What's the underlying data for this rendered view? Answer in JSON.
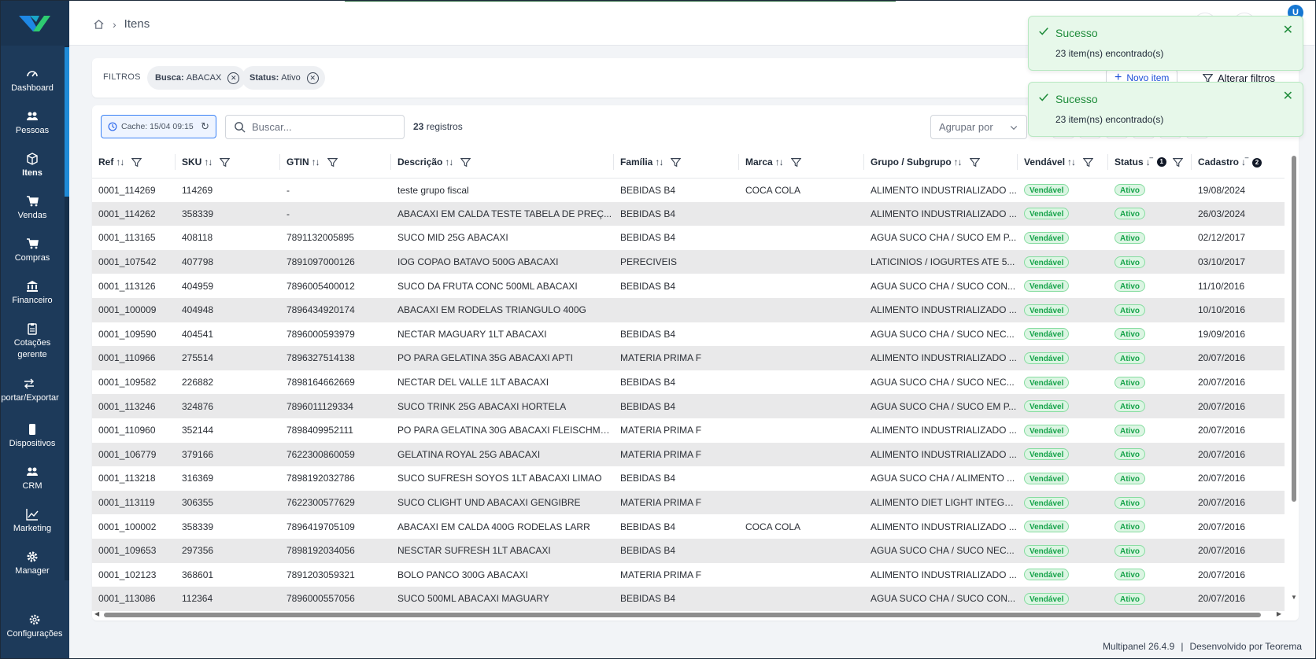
{
  "sidebar": {
    "items": [
      {
        "label": "Dashboard",
        "icon": "gauge-icon"
      },
      {
        "label": "Pessoas",
        "icon": "people-icon"
      },
      {
        "label": "Itens",
        "icon": "box-icon"
      },
      {
        "label": "Vendas",
        "icon": "cart-icon"
      },
      {
        "label": "Compras",
        "icon": "cart-icon"
      },
      {
        "label": "Financeiro",
        "icon": "bank-icon"
      },
      {
        "label": "Cotações",
        "label2": "gerente",
        "icon": "clipboard-icon"
      },
      {
        "label": "Importar/Exportar",
        "icon": "swap-icon"
      },
      {
        "label": "Dispositivos",
        "icon": "device-icon"
      },
      {
        "label": "CRM",
        "icon": "people-icon"
      },
      {
        "label": "Marketing",
        "icon": "chart-icon"
      },
      {
        "label": "Manager",
        "icon": "gear-icon"
      }
    ],
    "settings_label": "Configurações"
  },
  "header": {
    "breadcrumb_current": "Itens",
    "avatar_initial": "U"
  },
  "filters": {
    "title": "FILTROS",
    "chips": [
      {
        "key": "Busca:",
        "value": "ABACAX"
      },
      {
        "key": "Status:",
        "value": "Ativo"
      }
    ],
    "new_item_label": "Novo item",
    "alter_filters_label": "Alterar filtros"
  },
  "toolbar": {
    "cache_label": "Cache: 15/04 09:15",
    "search_placeholder": "Buscar...",
    "records_count": "23",
    "records_label": "registros",
    "group_by_placeholder": "Agrupar por"
  },
  "table": {
    "columns": [
      "Ref",
      "SKU",
      "GTIN",
      "Descrição",
      "Família",
      "Marca",
      "Grupo / Subgrupo",
      "Vendável",
      "Status",
      "Cadastro"
    ],
    "rows": [
      [
        "0001_114269",
        "114269",
        "-",
        "teste grupo fiscal",
        "BEBIDAS B4",
        "COCA COLA",
        "ALIMENTO INDUSTRIALIZADO ...",
        "Vendável",
        "Ativo",
        "19/08/2024"
      ],
      [
        "0001_114262",
        "358339",
        "-",
        "ABACAXI EM CALDA TESTE TABELA DE PREÇ...",
        "BEBIDAS B4",
        "",
        "ALIMENTO INDUSTRIALIZADO ...",
        "Vendável",
        "Ativo",
        "26/03/2024"
      ],
      [
        "0001_113165",
        "408118",
        "7891132005895",
        "SUCO MID 25G ABACAXI",
        "BEBIDAS B4",
        "",
        "AGUA SUCO CHA / SUCO EM P...",
        "Vendável",
        "Ativo",
        "02/12/2017"
      ],
      [
        "0001_107542",
        "407798",
        "7891097000126",
        "IOG COPAO BATAVO 500G ABACAXI",
        "PERECIVEIS",
        "",
        "LATICINIOS / IOGURTES ATE 5...",
        "Vendável",
        "Ativo",
        "03/10/2017"
      ],
      [
        "0001_113126",
        "404959",
        "7896005400012",
        "SUCO DA FRUTA CONC 500ML ABACAXI",
        "BEBIDAS B4",
        "",
        "AGUA SUCO CHA / SUCO CON...",
        "Vendável",
        "Ativo",
        "11/10/2016"
      ],
      [
        "0001_100009",
        "404948",
        "7896434920174",
        "ABACAXI EM RODELAS TRIANGULO 400G",
        "",
        "",
        "ALIMENTO INDUSTRIALIZADO ...",
        "Vendável",
        "Ativo",
        "10/10/2016"
      ],
      [
        "0001_109590",
        "404541",
        "7896000593979",
        "NECTAR MAGUARY 1LT ABACAXI",
        "BEBIDAS B4",
        "",
        "AGUA SUCO CHA / SUCO NEC...",
        "Vendável",
        "Ativo",
        "19/09/2016"
      ],
      [
        "0001_110966",
        "275514",
        "7896327514138",
        "PO PARA GELATINA 35G ABACAXI APTI",
        "MATERIA PRIMA F",
        "",
        "ALIMENTO INDUSTRIALIZADO ...",
        "Vendável",
        "Ativo",
        "20/07/2016"
      ],
      [
        "0001_109582",
        "226882",
        "7898164662669",
        "NECTAR DEL VALLE 1LT ABACAXI",
        "BEBIDAS B4",
        "",
        "AGUA SUCO CHA / SUCO NEC...",
        "Vendável",
        "Ativo",
        "20/07/2016"
      ],
      [
        "0001_113246",
        "324876",
        "7896011129334",
        "SUCO TRINK 25G ABACAXI HORTELA",
        "BEBIDAS B4",
        "",
        "AGUA SUCO CHA / SUCO EM P...",
        "Vendável",
        "Ativo",
        "20/07/2016"
      ],
      [
        "0001_110960",
        "352144",
        "7898409952111",
        "PO PARA GELATINA 30G ABACAXI FLEISCHMA...",
        "MATERIA PRIMA F",
        "",
        "ALIMENTO INDUSTRIALIZADO ...",
        "Vendável",
        "Ativo",
        "20/07/2016"
      ],
      [
        "0001_106779",
        "379166",
        "7622300860059",
        "GELATINA ROYAL 25G ABACAXI",
        "MATERIA PRIMA F",
        "",
        "ALIMENTO INDUSTRIALIZADO ...",
        "Vendável",
        "Ativo",
        "20/07/2016"
      ],
      [
        "0001_113218",
        "316369",
        "7898192032786",
        "SUCO SUFRESH SOYOS 1LT ABACAXI LIMAO",
        "BEBIDAS B4",
        "",
        "AGUA SUCO CHA / ALIMENTO ...",
        "Vendável",
        "Ativo",
        "20/07/2016"
      ],
      [
        "0001_113119",
        "306355",
        "7622300577629",
        "SUCO CLIGHT UND ABACAXI GENGIBRE",
        "MATERIA PRIMA F",
        "",
        "ALIMENTO DIET LIGHT INTEGR...",
        "Vendável",
        "Ativo",
        "20/07/2016"
      ],
      [
        "0001_100002",
        "358339",
        "7896419705109",
        "ABACAXI EM CALDA 400G RODELAS LARR",
        "BEBIDAS B4",
        "COCA COLA",
        "ALIMENTO INDUSTRIALIZADO ...",
        "Vendável",
        "Ativo",
        "20/07/2016"
      ],
      [
        "0001_109653",
        "297356",
        "7898192034056",
        "NESCTAR SUFRESH 1LT ABACAXI",
        "BEBIDAS B4",
        "",
        "AGUA SUCO CHA / SUCO NEC...",
        "Vendável",
        "Ativo",
        "20/07/2016"
      ],
      [
        "0001_102123",
        "368601",
        "7891203059321",
        "BOLO PANCO 300G ABACAXI",
        "MATERIA PRIMA F",
        "",
        "ALIMENTO INDUSTRIALIZADO ...",
        "Vendável",
        "Ativo",
        "20/07/2016"
      ],
      [
        "0001_113086",
        "112364",
        "7896000557056",
        "SUCO 500ML ABACAXI MAGUARY",
        "BEBIDAS B4",
        "",
        "AGUA SUCO CHA / SUCO CON...",
        "Vendável",
        "Ativo",
        "20/07/2016"
      ]
    ]
  },
  "toasts": [
    {
      "title": "Sucesso",
      "message": "23 item(ns) encontrado(s)"
    },
    {
      "title": "Sucesso",
      "message": "23 item(ns) encontrado(s)"
    }
  ],
  "footer": {
    "version": "Multipanel 26.4.9",
    "developer": "Desenvolvido por Teorema"
  },
  "colors": {
    "sidebar_bg": "#1d3a5a",
    "accent": "#1f8ad6",
    "success": "#1f8c3b",
    "logo_blue": "#1e88e5",
    "logo_green": "#2ecc71"
  }
}
